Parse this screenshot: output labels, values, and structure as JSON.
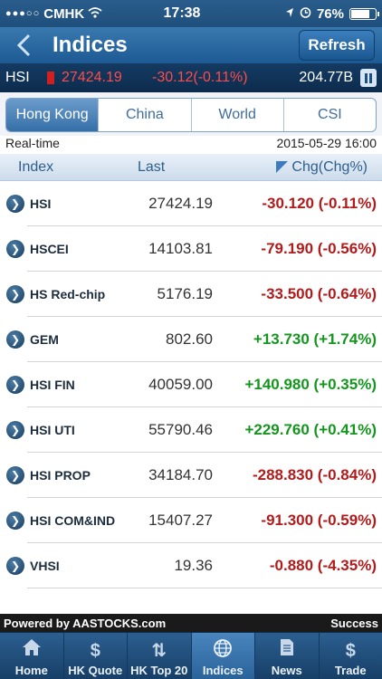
{
  "status_bar": {
    "carrier": "CMHK",
    "signal": "●●●○○",
    "time": "17:38",
    "battery": "76%",
    "battery_level": 0.76
  },
  "nav": {
    "title": "Indices",
    "refresh_label": "Refresh"
  },
  "ticker": {
    "name": "HSI",
    "last": "27424.19",
    "change": "-30.12(-0.11%)",
    "volume": "204.77B"
  },
  "tabs": [
    {
      "label": "Hong Kong"
    },
    {
      "label": "China"
    },
    {
      "label": "World"
    },
    {
      "label": "CSI"
    }
  ],
  "realtime": {
    "label": "Real-time",
    "timestamp": "2015-05-29 16:00"
  },
  "table": {
    "headers": {
      "index": "Index",
      "last": "Last",
      "change": "Chg(Chg%)"
    },
    "rows": [
      {
        "name": "HSI",
        "last": "27424.19",
        "change": "-30.120 (-0.11%)",
        "dir": "down"
      },
      {
        "name": "HSCEI",
        "last": "14103.81",
        "change": "-79.190 (-0.56%)",
        "dir": "down"
      },
      {
        "name": "HS Red-chip",
        "last": "5176.19",
        "change": "-33.500 (-0.64%)",
        "dir": "down"
      },
      {
        "name": "GEM",
        "last": "802.60",
        "change": "+13.730 (+1.74%)",
        "dir": "up"
      },
      {
        "name": "HSI FIN",
        "last": "40059.00",
        "change": "+140.980 (+0.35%)",
        "dir": "up"
      },
      {
        "name": "HSI UTI",
        "last": "55790.46",
        "change": "+229.760 (+0.41%)",
        "dir": "up"
      },
      {
        "name": "HSI PROP",
        "last": "34184.70",
        "change": "-288.830 (-0.84%)",
        "dir": "down"
      },
      {
        "name": "HSI COM&IND",
        "last": "15407.27",
        "change": "-91.300 (-0.59%)",
        "dir": "down"
      },
      {
        "name": "VHSI",
        "last": "19.36",
        "change": "-0.880 (-4.35%)",
        "dir": "down"
      }
    ]
  },
  "footer": {
    "powered_by": "Powered by AASTOCKS.com",
    "status": "Success"
  },
  "tabbar": [
    {
      "label": "Home",
      "icon": "home-icon"
    },
    {
      "label": "HK Quote",
      "icon": "dollar-icon"
    },
    {
      "label": "HK Top 20",
      "icon": "updown-arrows-icon"
    },
    {
      "label": "Indices",
      "icon": "globe-icon"
    },
    {
      "label": "News",
      "icon": "document-icon"
    },
    {
      "label": "Trade",
      "icon": "dollar-icon"
    }
  ],
  "colors": {
    "up": "#14961e",
    "down": "#b11b1b",
    "nav": "#1d5a93"
  }
}
